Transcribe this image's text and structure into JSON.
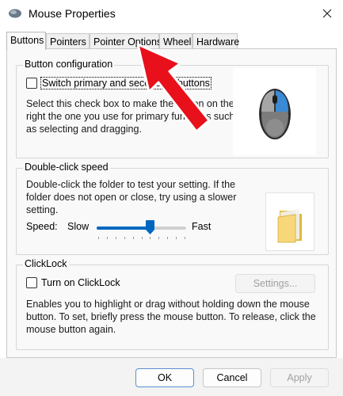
{
  "window": {
    "title": "Mouse Properties"
  },
  "tabs": [
    {
      "label": "Buttons"
    },
    {
      "label": "Pointers"
    },
    {
      "label": "Pointer Options"
    },
    {
      "label": "Wheel"
    },
    {
      "label": "Hardware"
    }
  ],
  "button_config": {
    "title": "Button configuration",
    "checkbox_label": "Switch primary and secondary buttons",
    "checked": false,
    "description_lines": [
      "Select this check box to make the button on the",
      "right the one you use for primary functions such",
      "as selecting and dragging."
    ]
  },
  "double_click": {
    "title": "Double-click speed",
    "description_lines": [
      "Double-click the folder to test your setting. If the",
      "folder does not open or close, try using a slower",
      "setting."
    ],
    "speed_label": "Speed:",
    "slow_label": "Slow",
    "fast_label": "Fast",
    "slider_value": 0.6
  },
  "clicklock": {
    "title": "ClickLock",
    "checkbox_label": "Turn on ClickLock",
    "checked": false,
    "settings_label": "Settings...",
    "description_lines": [
      "Enables you to highlight or drag without holding down the mouse",
      "button. To set, briefly press the mouse button. To release, click the",
      "mouse button again."
    ]
  },
  "footer": {
    "ok_label": "OK",
    "cancel_label": "Cancel",
    "apply_label": "Apply"
  },
  "colors": {
    "accent": "#0067c0",
    "annotation_arrow": "#e8101a"
  },
  "icons": {
    "app": "mouse-icon",
    "close": "close-icon",
    "mouse_picture": "mouse-picture-icon",
    "folder": "folder-icon",
    "annotation": "red-arrow-annotation"
  }
}
